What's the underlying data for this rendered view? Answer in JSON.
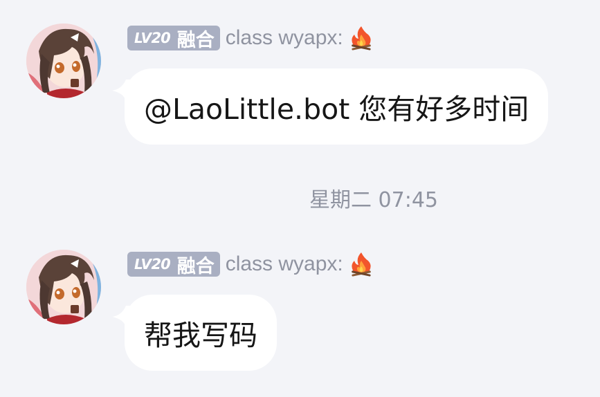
{
  "colors": {
    "background": "#f3f4f8",
    "bubble": "#ffffff",
    "badge": "#a9afc2",
    "muted_text": "#8f93a0"
  },
  "timestamp": "星期二 07:45",
  "messages": [
    {
      "level_label": "LV",
      "level_number": "20",
      "badge_title": "融合",
      "sender": "class wyapx:",
      "sender_icon": "fire-icon",
      "text": "@LaoLittle.bot 您有好多时间"
    },
    {
      "level_label": "LV",
      "level_number": "20",
      "badge_title": "融合",
      "sender": "class wyapx:",
      "sender_icon": "fire-icon",
      "text": "帮我写码"
    }
  ]
}
